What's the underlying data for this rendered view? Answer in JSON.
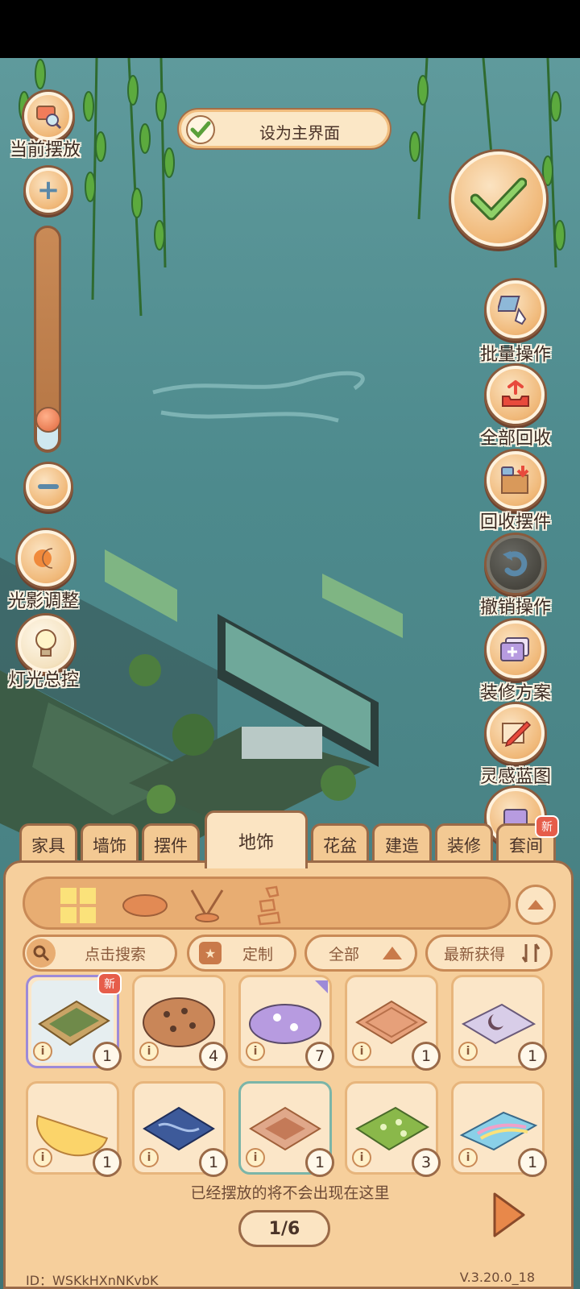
{
  "top_button": {
    "label": "设为主界面"
  },
  "left_controls": {
    "current_place": "当前摆放",
    "light_shadow": "光影调整",
    "light_master": "灯光总控"
  },
  "right_controls": {
    "batch": "批量操作",
    "recycle_all": "全部回收",
    "recycle_items": "回收摆件",
    "undo": "撤销操作",
    "plans": "装修方案",
    "blueprint": "灵感蓝图"
  },
  "zoom_level": 0.18,
  "tabs": [
    "家具",
    "墙饰",
    "摆件",
    "地饰",
    "花盆",
    "建造",
    "装修",
    "套间"
  ],
  "active_tab": "地饰",
  "tab_badge": "新",
  "filters": {
    "search_placeholder": "点击搜索",
    "custom": "定制",
    "all": "全部",
    "sort": "最新获得"
  },
  "items": [
    {
      "count": "1",
      "badge": "新"
    },
    {
      "count": "4"
    },
    {
      "count": "7"
    },
    {
      "count": "1"
    },
    {
      "count": "1"
    },
    {
      "count": "1"
    },
    {
      "count": "1"
    },
    {
      "count": "1"
    },
    {
      "count": "3"
    },
    {
      "count": "1"
    }
  ],
  "info_glyph": "i",
  "hint": "已经摆放的将不会出现在这里",
  "pager": "1/6",
  "footer": {
    "id": "ID：WSKkHXnNKvbK",
    "version": "V.3.20.0_18"
  }
}
